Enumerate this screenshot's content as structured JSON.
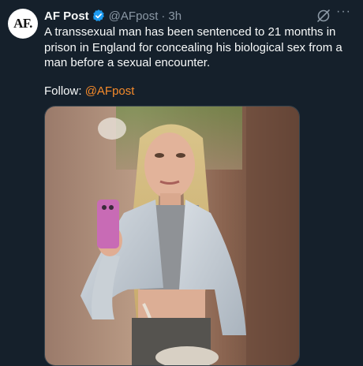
{
  "tweet": {
    "avatar_text": "AF.",
    "display_name": "AF Post",
    "handle": "@AFpost",
    "separator": "·",
    "time": "3h",
    "text": "A transsexual man has been sentenced to 21 months in prison in England for concealing his biological sex from a man before a sexual encounter.",
    "follow_label": "Follow:",
    "follow_mention": "@AFpost",
    "more_label": "···"
  },
  "colors": {
    "background": "#15202b",
    "verified": "#1d9bf0",
    "mention": "#f58a2b",
    "secondary_text": "#8b98a5"
  },
  "icons": [
    "verified-badge-icon",
    "grok-icon",
    "more-options-icon"
  ]
}
